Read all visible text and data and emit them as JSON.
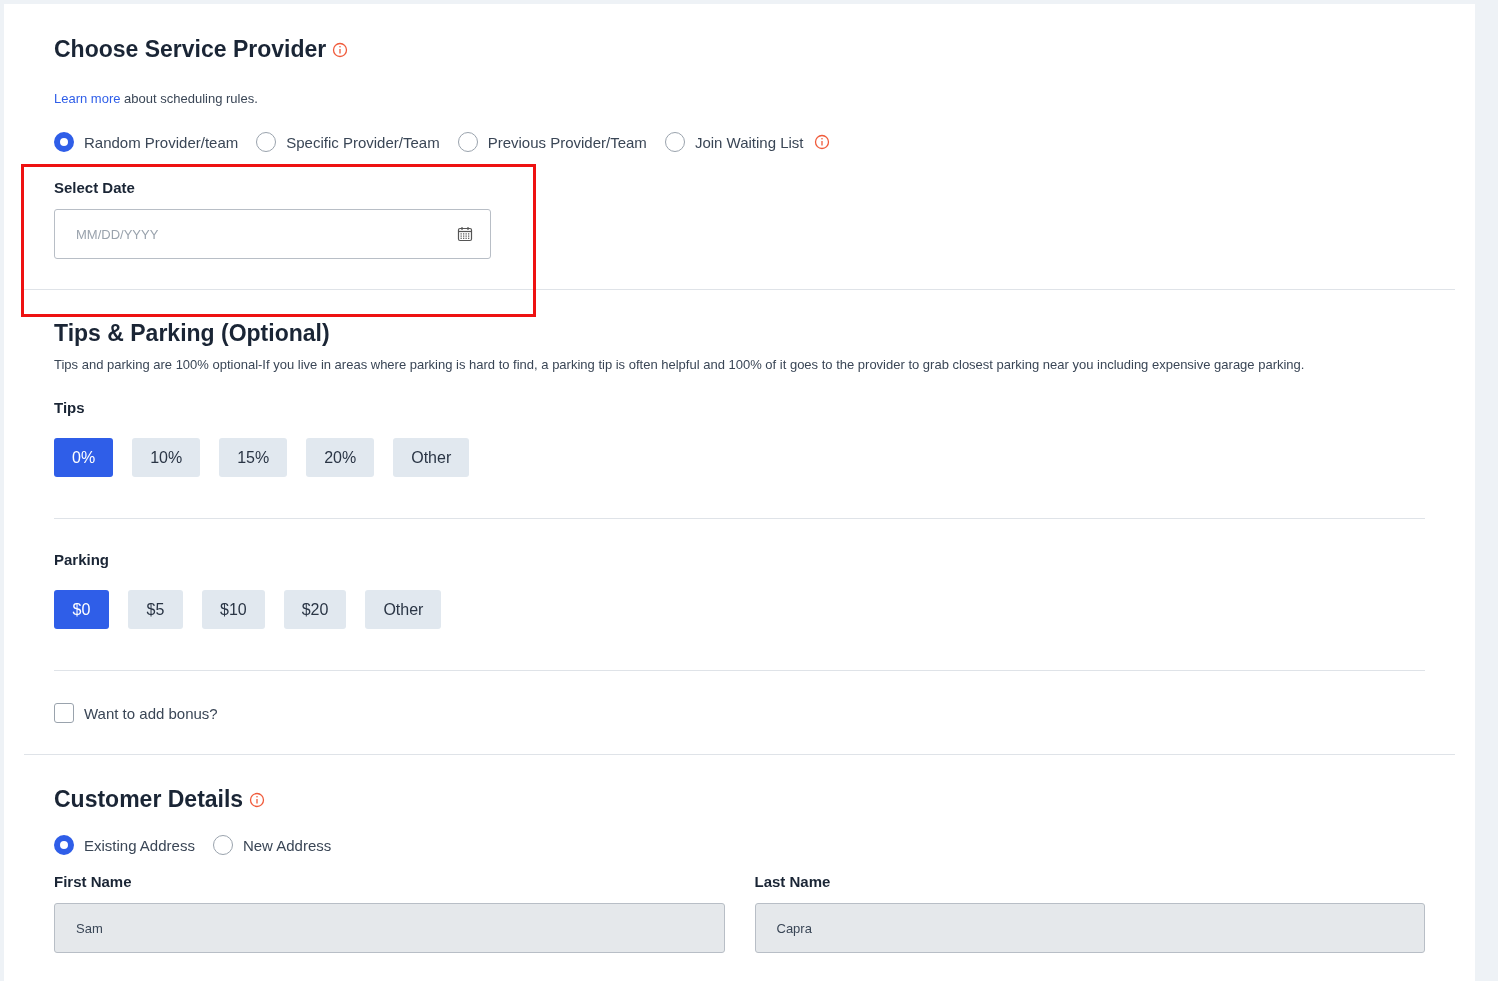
{
  "provider_section": {
    "title": "Choose Service Provider",
    "info_link": "Learn more",
    "info_text": "about scheduling rules.",
    "options": [
      {
        "label": "Random Provider/team",
        "selected": true,
        "info": false
      },
      {
        "label": "Specific Provider/Team",
        "selected": false,
        "info": false
      },
      {
        "label": "Previous Provider/Team",
        "selected": false,
        "info": false
      },
      {
        "label": "Join Waiting List",
        "selected": false,
        "info": true
      }
    ],
    "date": {
      "label": "Select Date",
      "placeholder": "MM/DD/YYYY"
    }
  },
  "tips_section": {
    "title": "Tips & Parking (Optional)",
    "description": "Tips and parking are 100% optional-If you live in areas where parking is hard to find, a parking tip is often helpful and 100% of it goes to the provider to grab closest parking near you including expensive garage parking.",
    "groups": [
      {
        "label": "Tips",
        "options": [
          {
            "label": "0%",
            "selected": true
          },
          {
            "label": "10%",
            "selected": false
          },
          {
            "label": "15%",
            "selected": false
          },
          {
            "label": "20%",
            "selected": false
          },
          {
            "label": "Other",
            "selected": false
          }
        ]
      },
      {
        "label": "Parking",
        "options": [
          {
            "label": "$0",
            "selected": true
          },
          {
            "label": "$5",
            "selected": false
          },
          {
            "label": "$10",
            "selected": false
          },
          {
            "label": "$20",
            "selected": false
          },
          {
            "label": "Other",
            "selected": false
          }
        ]
      }
    ],
    "bonus": {
      "label": "Want to add bonus?",
      "checked": false
    }
  },
  "customer_section": {
    "title": "Customer Details",
    "address_options": [
      {
        "label": "Existing Address",
        "selected": true
      },
      {
        "label": "New Address",
        "selected": false
      }
    ],
    "fields": [
      {
        "label": "First Name",
        "value": "Sam",
        "disabled": true
      },
      {
        "label": "Last Name",
        "value": "Capra",
        "disabled": true
      }
    ]
  }
}
